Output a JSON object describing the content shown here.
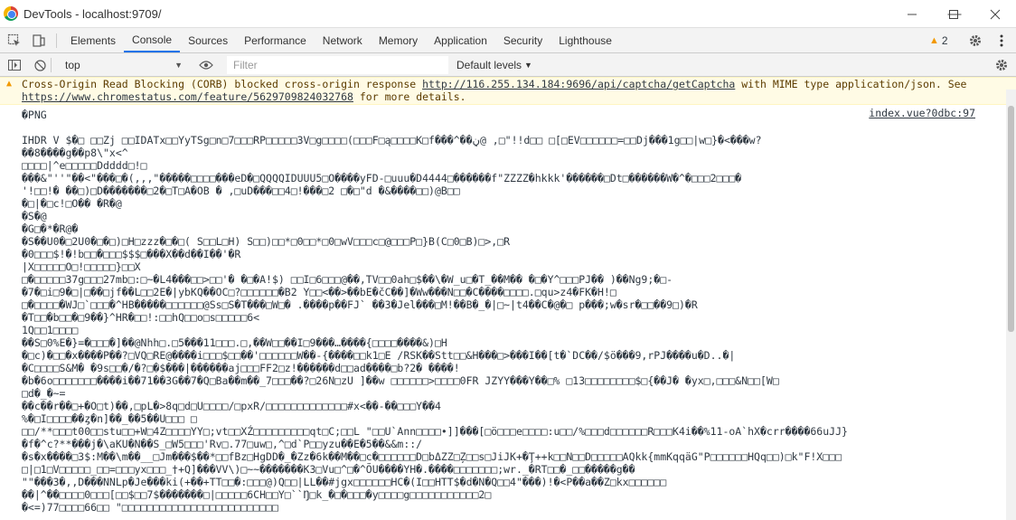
{
  "window": {
    "title": "DevTools - localhost:9709/",
    "controls": {
      "minimize": "—",
      "maximize": "☐",
      "close": "✕"
    }
  },
  "tabs": [
    "Elements",
    "Console",
    "Sources",
    "Performance",
    "Network",
    "Memory",
    "Application",
    "Security",
    "Lighthouse"
  ],
  "active_tab": "Console",
  "warning_count": "2",
  "console_toolbar": {
    "context": "top",
    "filter_placeholder": "Filter",
    "levels": "Default levels"
  },
  "warning": {
    "pre": "Cross-Origin Read Blocking (CORB) blocked cross-origin response ",
    "url1": "http://116.255.134.184:9696/api/captcha/getCaptcha",
    "mid": " with MIME type application/json. See ",
    "url2": "https://www.chromestatus.com/feature/5629709824032768",
    "post": " for more details."
  },
  "log": {
    "source": "index.vue?0dbc:97",
    "lines": [
      "�PNG",
      "",
      "  IHDR   V   $�□   □□Zj  □□IDATx□□YyTSg□n□7□□□RP□□□□□3V□g□□□□(□□□F□ą□□□□K□f���^��ڼ@ ,□\"!!d□□ □[□EV□□□□□□=□□Dj���1g□□|w□}�<���w?",
      "��8����g��p8\\\"x<^",
      "□□□□|^e□□□□□Ddddd□!□",
      "���&\"''\"��<\"���□�(,,,\"�����□□□□���eD�□QQQQIDUUU5□O����yFD-□uuu�D4444□������f\"ZZZZ�hkkk'������□Dt□������W�^�□□□2□□□�",
      "'!□□!� ��□)□D�������□2�□T□A�OB � ,□uD���□□4□!���□2 □�□\"d �&����□□)@B□□",
      "�□|�□c!□O�� �R�@",
      "�S�@",
      "�G□�*�R@�",
      "�S��U0�□2U0�□�□)□H□zzz�□�□( S□□L□H) S□□)□□*□0□□*□0□wV□□□c□@□□□P□}B(C□0□B)□>,□R",
      "�0□□□$!�!b□□�□□□$$$□���X��d��I��'�R",
      "|X□□□□□O□!□□□□□}□□X",
      "□�□□□□□37g□□□27mb□:□~�L4���□□>□□'� �□�A!$) □□I□6□□□@��,TV□□0ah□$��\\�W_u□�T_��M�� �□�Y^□□□PJ��  )��Ng9;�□-",
      "�7�□i□9�□|□��□jf��L□□2E�|ybKQ��OC□?□□□□□□�B2 Y□□<��>��bE�čC��]�Ww���N□□�C����□□□□.□qu>z4�FK�H!□",
      "□�□□□□�WJ□`□□□�^HB�����□□□□□□@Ss□S�T���□W□� .����p��FJ` ��3�Jel���□M!��B�_�|□~|t4��C�@�□ p���;w�sr�□□��9□)�R",
      "�T□□�b□□�□9��}^HR�□□!:□□hQ□□o□s□□□□□6<",
      "1Q□□1□□□□",
      "��S□0%E�}=�□□□�]��@Nhh□.□5���11□□□.□,��W□□��I□9���…����{□□□□����&)□H",
      "�□c)�□□�x����P��?□VQ□RE@����i□□□$□□��'□□□□□□W��-{����□□k1□E /RSK��Stt□□&H���□>���I��[t�`DC��/$ö���9,rPJ����u�D..�|",
      "�C□□□□S&M� �9s□□�/�?□�$���|������aj□□□FF2□z!������d□□ad����□b?2� ����!",
      "�b�6o□□□□□□□����i��71��3G��7�Q□Ba��m��_7□□□��?□26N□zU ]��w □□□□□□>□□□□0FR JZYY���Y��□% □13□□□□□□□□$□{��J� �yx□,□□□&N□□[W□",
      "□d�_�~=",
      "��c��r��□+�O□t)��,□pL�>8q□d□U□□□□/□pxR/□□□□□□□□□□□□□#x<��-��□□□Y��4",
      "%�□I□□□□��ȥ�n]��_��5��U□□□    □",
      "□□/**□□□t00□□stu□□+W□4Z□□□□YY□;vt□□XŹ□□□□□□□□□qt□C;□□L \"□□U`Ann□□□□•]]���[□ö□□□e□□□□:u□□/%□□□d□□□□□□R□□□K4i��%11-oA`hX�crr����66uJJ}",
      "�f�^c?**���j�\\aKU�N��S_□W5□□□'Rv□.77□uw□,^□d`P□□yzu��E�5��&&m::/",
      "�s�x����□3$:M��\\m��__□Jm���$��*□□fBz□HgDD�_�Zz�6k��M��□c�□□□□□□D□bΔZZ□Z̦□□s□JiJK+�Ţ++k□□N□□D□□□□□AQkk{mmKqqäG\"P□□□□□□HQq□□)□k\"F!X□□□",
      "□|□1□V□□□□□_□□=□□□yx□□□_†+Q]���VV\\)□~~�������K3□Vu□^□�^ÕU����YH�.����□□□□□□□;wr._�RT□□�_□□�����g��",
      "\"\"���3�,,D���NNLp�Je���ki(+��+TT□□�:□□□@)Q□□|LL��#jgx□□□□□□HC�(I□□HTT$�d�N�Q□□4\"���)!�<P��a��Z□kx□□□□□□",
      "��|^��□□□□0□□□[□□$□□7$�������□|□□□□□6CH□□Y□``Ŋ□k_�□�□□□�y□□□□g□□□□□□□□□□□2□",
      "�<=)77□□□□66□□ \"□□□□□□□□□□□□□□□□□□□□□□□□□"
    ]
  }
}
